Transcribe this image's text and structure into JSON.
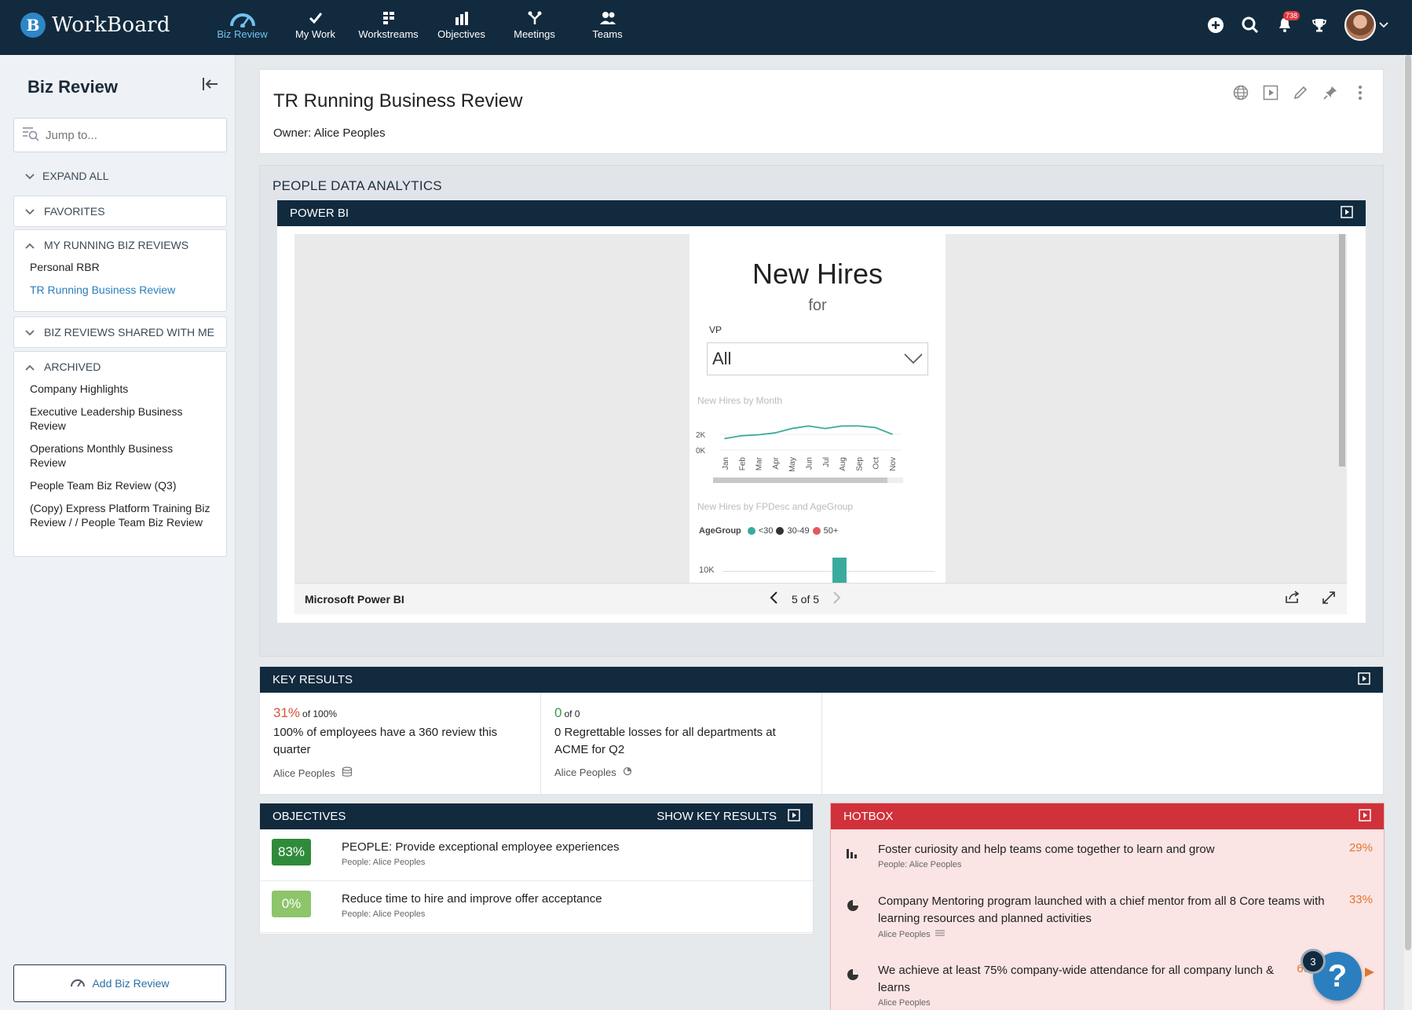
{
  "app": {
    "name": "WorkBoard",
    "logo_letter": "B"
  },
  "nav": [
    {
      "label": "Biz Review",
      "icon": "gauge-icon",
      "active": true
    },
    {
      "label": "My Work",
      "icon": "check-icon"
    },
    {
      "label": "Workstreams",
      "icon": "workstreams-icon"
    },
    {
      "label": "Objectives",
      "icon": "bar-chart-icon"
    },
    {
      "label": "Meetings",
      "icon": "meetings-icon"
    },
    {
      "label": "Teams",
      "icon": "people-icon"
    }
  ],
  "topbar": {
    "notification_count": "738"
  },
  "sidebar": {
    "title": "Biz Review",
    "jump_placeholder": "Jump to...",
    "expand_all": "EXPAND ALL",
    "favorites": "FAVORITES",
    "my_running": {
      "label": "MY RUNNING BIZ REVIEWS",
      "items": [
        "Personal RBR",
        "TR Running Business Review"
      ]
    },
    "shared": "BIZ REVIEWS SHARED WITH ME",
    "archived": {
      "label": "ARCHIVED",
      "items": [
        "Company Highlights",
        "Executive Leadership Business Review",
        "Operations Monthly Business Review",
        "People Team Biz Review (Q3)",
        "(Copy) Express Platform Training Biz Review / / People Team Biz Review"
      ]
    },
    "add_button": "Add Biz Review"
  },
  "header": {
    "title": "TR Running Business Review",
    "owner_label": "Owner:",
    "owner": "Alice Peoples"
  },
  "section": {
    "title": "PEOPLE DATA ANALYTICS"
  },
  "powerbi": {
    "bar_title": "POWER BI",
    "report": {
      "title": "New Hires",
      "subtitle": "for",
      "filter_label": "VP",
      "filter_value": "All",
      "line_title": "New Hires by Month",
      "y_ticks": [
        "2K",
        "0K"
      ],
      "bar_title": "New Hires by FPDesc and AgeGroup",
      "legend_title": "AgeGroup",
      "legend": [
        {
          "name": "<30",
          "color": "#3aaa9c"
        },
        {
          "name": "30-49",
          "color": "#333333"
        },
        {
          "name": "50+",
          "color": "#e05a5a"
        }
      ],
      "bar_tick": "10K"
    },
    "footer_label": "Microsoft Power BI",
    "pager": "5 of 5"
  },
  "chart_data": {
    "type": "line",
    "title": "New Hires by Month",
    "categories": [
      "Jan",
      "Feb",
      "Mar",
      "Apr",
      "May",
      "Jun",
      "Jul",
      "Aug",
      "Sep",
      "Oct",
      "Nov"
    ],
    "values": [
      1700,
      2150,
      2300,
      2600,
      3300,
      3700,
      3300,
      3700,
      3700,
      3450,
      2400
    ],
    "ylim": [
      0,
      4000
    ],
    "y_ticks": [
      "2K",
      "0K"
    ]
  },
  "key_results": {
    "bar_title": "KEY RESULTS",
    "items": [
      {
        "pct": "31%",
        "of": "of 100%",
        "name": "100% of employees have a 360 review this quarter",
        "owner": "Alice Peoples",
        "color": "#d2553a"
      },
      {
        "pct": "0",
        "of": "of 0",
        "name": "0 Regrettable losses for all departments at ACME for Q2",
        "owner": "Alice Peoples",
        "color": "#3a9a4a"
      }
    ]
  },
  "objectives": {
    "bar_title": "OBJECTIVES",
    "show_kr": "SHOW KEY RESULTS",
    "items": [
      {
        "pct": "83%",
        "progress": 0.83,
        "name": "PEOPLE: Provide exceptional employee experiences",
        "owner": "People: Alice Peoples",
        "color": "#2f8b3a"
      },
      {
        "pct": "0%",
        "progress": 0.0,
        "name": "Reduce time to hire and improve offer acceptance",
        "owner": "People: Alice Peoples",
        "color": "#8cc56a"
      }
    ]
  },
  "hotbox": {
    "bar_title": "HOTBOX",
    "items": [
      {
        "name": "Foster curiosity and help teams come together to learn and grow",
        "owner": "People: Alice Peoples",
        "pct": "29%",
        "icon": "bar-chart-icon"
      },
      {
        "name": "Company Mentoring program launched with a chief mentor from all 8 Core teams with learning resources and planned activities",
        "owner": "Alice Peoples",
        "pct": "33%",
        "icon": "pie-icon"
      },
      {
        "name": "We achieve at least 75% company-wide attendance for all company lunch & learns",
        "owner": "Alice Peoples",
        "pct": "60",
        "icon": "pie-icon"
      }
    ]
  },
  "help": {
    "label": "?",
    "badge": "3"
  }
}
